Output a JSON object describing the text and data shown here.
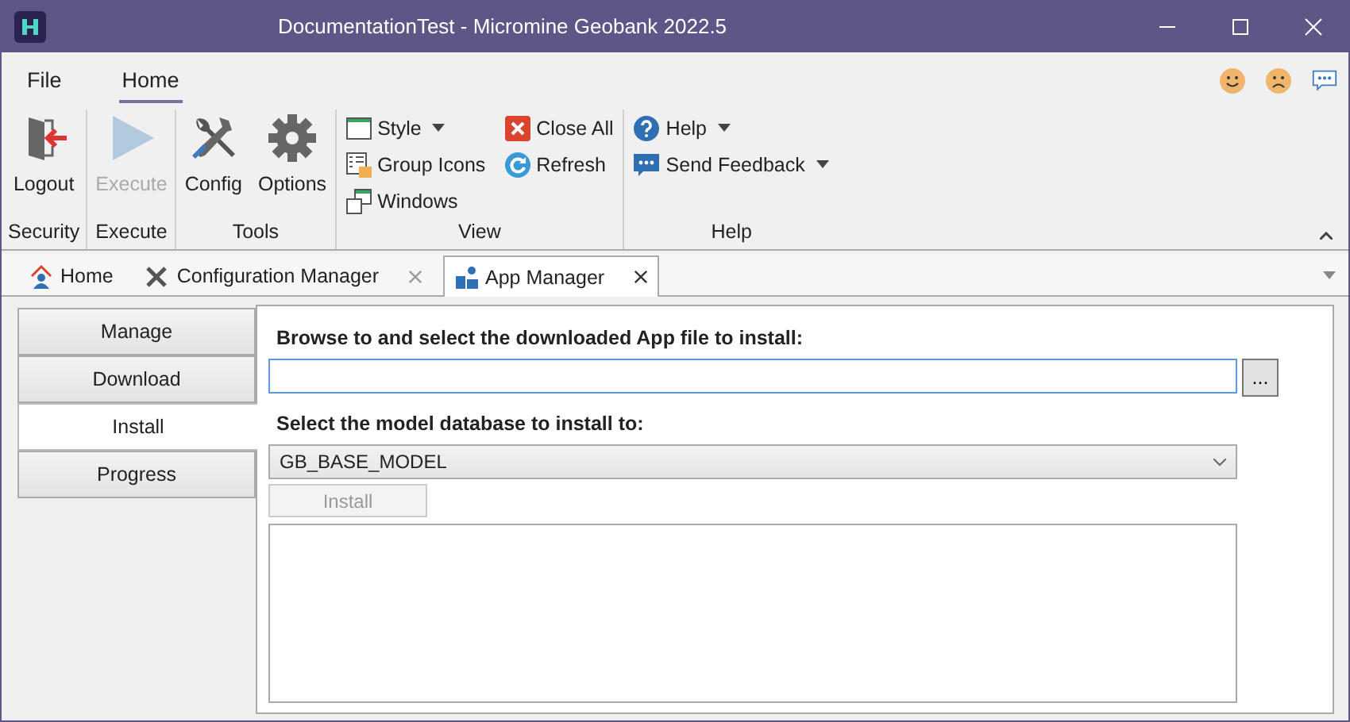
{
  "window": {
    "title": "DocumentationTest - Micromine Geobank 2022.5"
  },
  "menu_tabs": [
    {
      "label": "File",
      "selected": false
    },
    {
      "label": "Home",
      "selected": true
    }
  ],
  "ribbon_groups": [
    {
      "label": "Security",
      "items": [
        {
          "label": "Logout",
          "kind": "large",
          "disabled": false
        }
      ]
    },
    {
      "label": "Execute",
      "items": [
        {
          "label": "Execute",
          "kind": "large",
          "disabled": true
        }
      ]
    },
    {
      "label": "Tools",
      "items": [
        {
          "label": "Config",
          "kind": "large",
          "disabled": false
        },
        {
          "label": "Options",
          "kind": "large",
          "disabled": false
        }
      ]
    },
    {
      "label": "View",
      "items": [
        {
          "label": "Style",
          "kind": "small",
          "dropdown": true
        },
        {
          "label": "Group Icons",
          "kind": "small",
          "dropdown": false
        },
        {
          "label": "Windows",
          "kind": "small",
          "dropdown": false
        },
        {
          "label": "Close All",
          "kind": "small",
          "dropdown": false
        },
        {
          "label": "Refresh",
          "kind": "small",
          "dropdown": false
        }
      ]
    },
    {
      "label": "Help",
      "items": [
        {
          "label": "Help",
          "kind": "small",
          "dropdown": true
        },
        {
          "label": "Send Feedback",
          "kind": "small",
          "dropdown": true
        }
      ]
    }
  ],
  "doc_tabs": [
    {
      "label": "Home",
      "selected": false,
      "closable": false
    },
    {
      "label": "Configuration Manager",
      "selected": false,
      "closable": true
    },
    {
      "label": "App Manager",
      "selected": true,
      "closable": true
    }
  ],
  "side_nav": [
    {
      "label": "Manage",
      "selected": false
    },
    {
      "label": "Download",
      "selected": false
    },
    {
      "label": "Install",
      "selected": true
    },
    {
      "label": "Progress",
      "selected": false
    }
  ],
  "form": {
    "file_label": "Browse to and select the downloaded App file to install:",
    "browse_button": "...",
    "db_label": "Select the model database to install to:",
    "db_value": "GB_BASE_MODEL",
    "install_button": {
      "label": "Install",
      "disabled": true
    }
  }
}
